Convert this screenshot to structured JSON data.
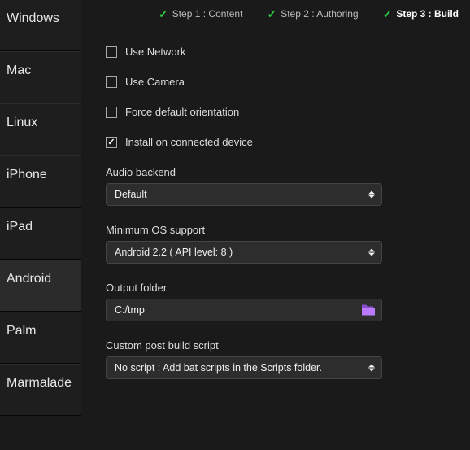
{
  "sidebar": {
    "items": [
      {
        "label": "Windows"
      },
      {
        "label": "Mac"
      },
      {
        "label": "Linux"
      },
      {
        "label": "iPhone"
      },
      {
        "label": "iPad"
      },
      {
        "label": "Android"
      },
      {
        "label": "Palm"
      },
      {
        "label": "Marmalade"
      }
    ],
    "active_index": 5
  },
  "steps": {
    "items": [
      {
        "label": "Step 1 : Content"
      },
      {
        "label": "Step 2 : Authoring"
      },
      {
        "label": "Step 3 : Build"
      }
    ],
    "active_index": 2
  },
  "checkboxes": {
    "use_network": {
      "label": "Use Network",
      "checked": false
    },
    "use_camera": {
      "label": "Use Camera",
      "checked": false
    },
    "force_orientation": {
      "label": "Force default orientation",
      "checked": false
    },
    "install_device": {
      "label": "Install on connected device",
      "checked": true
    }
  },
  "fields": {
    "audio_backend": {
      "label": "Audio backend",
      "value": "Default"
    },
    "min_os": {
      "label": "Minimum OS support",
      "value": "Android 2.2 ( API level: 8 )"
    },
    "output_folder": {
      "label": "Output folder",
      "value": "C:/tmp"
    },
    "post_build": {
      "label": "Custom post build script",
      "value": "No script : Add bat scripts in the Scripts folder."
    }
  }
}
